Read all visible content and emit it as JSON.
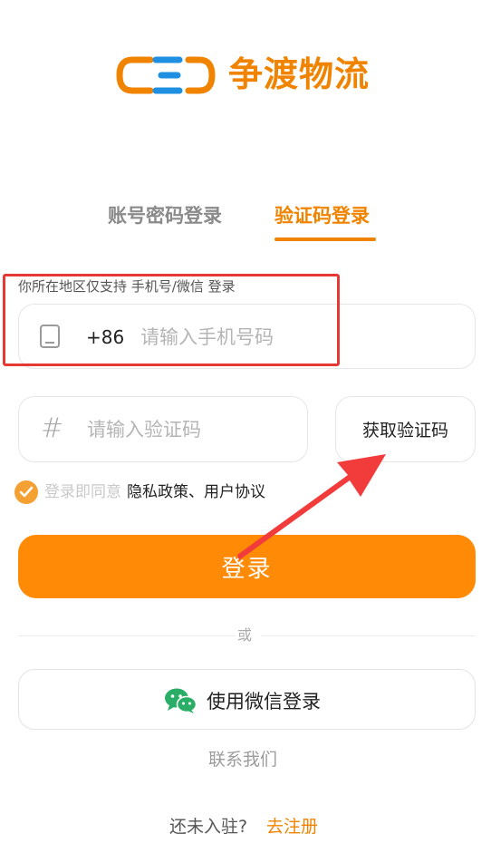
{
  "brand": {
    "logo_icon": "ced-logo-icon",
    "name": "争渡物流",
    "accent_color": "#f08300"
  },
  "tabs": [
    {
      "label": "账号密码登录",
      "active": false
    },
    {
      "label": "验证码登录",
      "active": true
    }
  ],
  "form": {
    "region_note": "你所在地区仅支持 手机号/微信 登录",
    "phone": {
      "icon": "phone-icon",
      "country_code": "+86",
      "placeholder": "请输入手机号码",
      "value": ""
    },
    "code": {
      "icon": "hash-icon",
      "placeholder": "请输入验证码",
      "value": "",
      "get_code_label": "获取验证码"
    },
    "agreement": {
      "checked": true,
      "prefix": "登录即同意",
      "links_text": "隐私政策、用户协议"
    },
    "login_label": "登录",
    "login_color": "#ff8a05"
  },
  "divider_text": "或",
  "wechat": {
    "icon": "wechat-icon",
    "label": "使用微信登录",
    "icon_color": "#2aae67"
  },
  "contact_label": "联系我们",
  "register": {
    "prompt": "还未入驻?",
    "link_label": "去注册"
  },
  "annotations": {
    "highlight_color": "#e53935",
    "arrow_icon": "red-arrow-icon"
  }
}
